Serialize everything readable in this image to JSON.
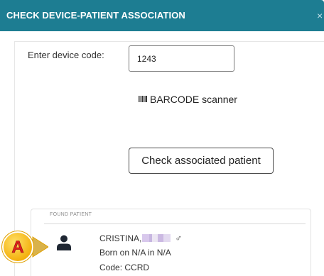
{
  "dialog": {
    "title": "CHECK DEVICE-PATIENT ASSOCIATION",
    "close_glyph": "×"
  },
  "device": {
    "label": "Enter device code:",
    "code_value": "1243"
  },
  "barcode": {
    "icon": "barcode-icon",
    "label": "BARCODE scanner"
  },
  "check_button": {
    "label": "Check associated patient"
  },
  "found_patient": {
    "section_label": "FOUND PATIENT",
    "icon": "person-icon",
    "name": "CRISTINA,",
    "gender_symbol": "♂",
    "born": "Born on N/A in N/A",
    "code": "Code: CCRD"
  },
  "annotation": {
    "callout_letter": "A",
    "callout_color": "#f0a800"
  },
  "colors": {
    "header": "#1d7d92",
    "header_text": "#ffffff"
  }
}
